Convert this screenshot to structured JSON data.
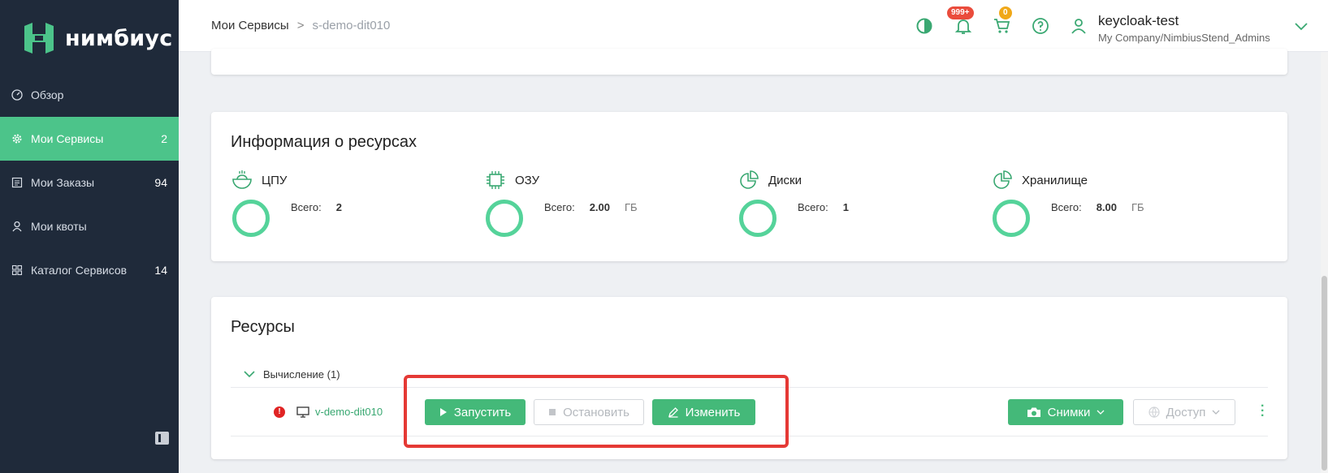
{
  "brand": {
    "name": "нимбиус",
    "accent": "#4cc48a",
    "sidebar_bg": "#1f2a3a"
  },
  "sidebar": {
    "items": [
      {
        "label": "Обзор",
        "count": "",
        "icon": "gauge-icon",
        "active": false
      },
      {
        "label": "Мои Сервисы",
        "count": "2",
        "icon": "gear-icon",
        "active": true
      },
      {
        "label": "Мои Заказы",
        "count": "94",
        "icon": "list-icon",
        "active": false
      },
      {
        "label": "Мои квоты",
        "count": "",
        "icon": "user-icon",
        "active": false
      },
      {
        "label": "Каталог Сервисов",
        "count": "14",
        "icon": "grid-icon",
        "active": false
      }
    ]
  },
  "header": {
    "breadcrumb": {
      "root": "Мои Сервисы",
      "separator": ">",
      "current": "s-demo-dit010"
    },
    "notifications_badge": "999+",
    "cart_badge": "0",
    "user": {
      "name": "keycloak-test",
      "org": "My Company/NimbiusStend_Admins"
    }
  },
  "resource_info": {
    "title": "Информация о ресурсах",
    "metrics": [
      {
        "label": "ЦПУ",
        "total_label": "Всего:",
        "total": "2",
        "unit": "",
        "icon": "cpu-bowl-icon"
      },
      {
        "label": "ОЗУ",
        "total_label": "Всего:",
        "total": "2.00",
        "unit": "ГБ",
        "icon": "chip-icon"
      },
      {
        "label": "Диски",
        "total_label": "Всего:",
        "total": "1",
        "unit": "",
        "icon": "pie-icon"
      },
      {
        "label": "Хранилище",
        "total_label": "Всего:",
        "total": "8.00",
        "unit": "ГБ",
        "icon": "pie-icon"
      }
    ]
  },
  "resources": {
    "title": "Ресурсы",
    "group": {
      "label": "Вычисление (1)"
    },
    "vm": {
      "name": "v-demo-dit010",
      "error_badge": "!",
      "buttons": {
        "start": "Запустить",
        "stop": "Остановить",
        "edit": "Изменить",
        "snapshots": "Снимки",
        "access": "Доступ"
      }
    }
  }
}
